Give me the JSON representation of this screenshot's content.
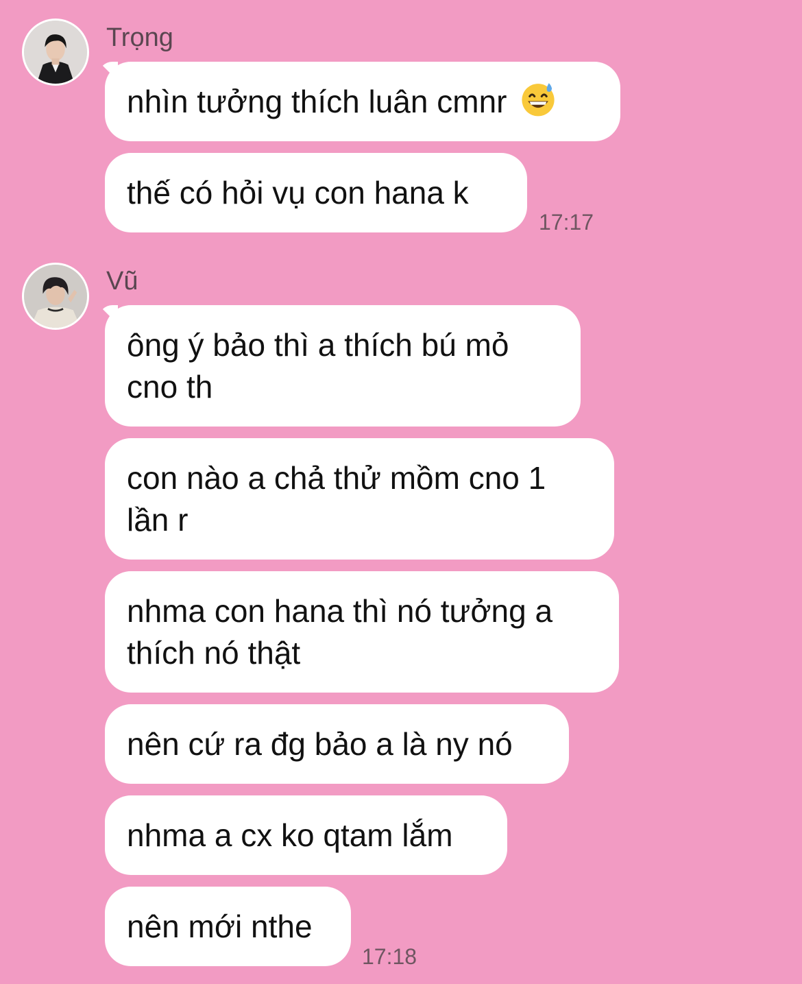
{
  "groups": [
    {
      "sender": "Trọng",
      "messages": [
        "nhìn tưởng thích luân cmnr",
        "thế có hỏi vụ con hana k"
      ],
      "emoji": "grinning-sweat-emoji",
      "time": "17:17"
    },
    {
      "sender": "Vũ",
      "messages": [
        "ông ý bảo thì a thích bú mỏ cno th",
        "con nào a chả thử mồm cno 1 lần r",
        "nhma con hana thì nó tưởng a thích nó thật",
        "nên cứ ra đg bảo a là ny nó",
        "nhma a cx ko qtam lắm",
        "nên mới nthe"
      ],
      "time": "17:18"
    }
  ],
  "colors": {
    "background": "#f29bc3",
    "bubble": "#ffffff",
    "text": "#111111",
    "meta": "#6f5661"
  }
}
